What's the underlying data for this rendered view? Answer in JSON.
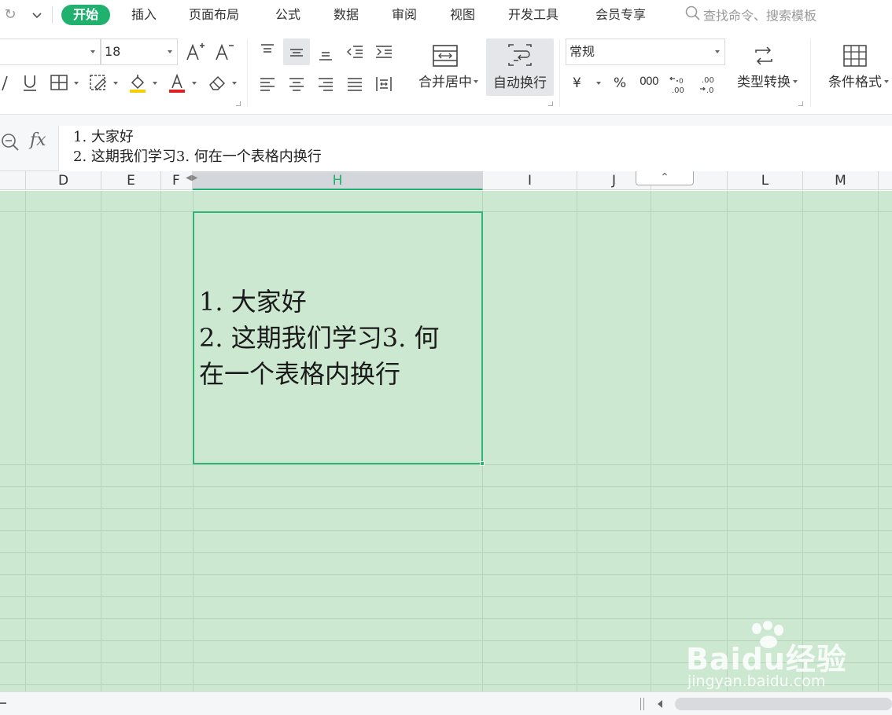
{
  "menu": {
    "tabs": [
      "开始",
      "插入",
      "页面布局",
      "公式",
      "数据",
      "审阅",
      "视图",
      "开发工具",
      "会员专享"
    ],
    "active_tab": "开始",
    "search_placeholder": "查找命令、搜索模板"
  },
  "ribbon": {
    "font_size": "18",
    "merge_center_label": "合并居中",
    "wrap_text_label": "自动换行",
    "number_format": "常规",
    "type_convert_label": "类型转换",
    "conditional_format_label": "条件格式",
    "currency_symbol": "¥",
    "percent_symbol": "%",
    "thousands_symbol": "000"
  },
  "formula_bar": {
    "fx_label": "fx",
    "lines": [
      "1. 大家好",
      "2. 这期我们学习3. 何在一个表格内换行"
    ]
  },
  "columns": [
    "D",
    "E",
    "F",
    "H",
    "I",
    "J",
    "L",
    "M"
  ],
  "active_column": "H",
  "selected_cell": {
    "lines": [
      "1. 大家好",
      "2. 这期我们学习3. 何",
      "在一个表格内换行"
    ]
  },
  "watermark": {
    "brand": "Baidu经验",
    "site": "jingyan.baidu.com"
  },
  "colors": {
    "accent": "#1fb16d",
    "grid_fill": "#cde8d1",
    "grid_line": "#b9d2bd"
  }
}
